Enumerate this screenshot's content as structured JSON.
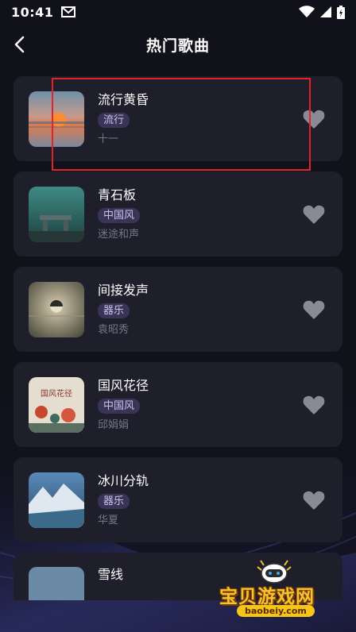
{
  "status_bar": {
    "time": "10:41"
  },
  "header": {
    "title": "热门歌曲"
  },
  "songs": [
    {
      "title": "流行黄昏",
      "tag": "流行",
      "artist": "十一"
    },
    {
      "title": "青石板",
      "tag": "中国风",
      "artist": "迷途和声"
    },
    {
      "title": "间接发声",
      "tag": "器乐",
      "artist": "袁昭秀"
    },
    {
      "title": "国风花径",
      "tag": "中国风",
      "artist": "邱娟娟"
    },
    {
      "title": "冰川分轨",
      "tag": "器乐",
      "artist": "华夏"
    },
    {
      "title": "雪线"
    }
  ],
  "watermark": {
    "brand": "宝贝游戏网",
    "url": "baobeiy.com"
  },
  "colors": {
    "highlight": "#e2232a",
    "tag_bg": "#3a3557",
    "card_bg": "#1f1e2b"
  }
}
